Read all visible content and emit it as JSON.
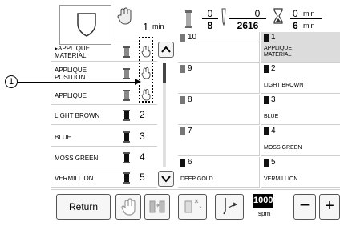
{
  "header": {
    "time_value": "1",
    "time_unit": "min",
    "stitch_fraction_top": "0",
    "stitch_fraction_bottom": "8",
    "stitch_count_top": "0",
    "stitch_count_bottom": "2616",
    "remaining_top_value": "0",
    "remaining_top_unit": "min",
    "remaining_bottom_value": "6",
    "remaining_bottom_unit": "min"
  },
  "color_list": [
    {
      "label": "APPLIQUE\nMATERIAL",
      "type": "hand",
      "current": true
    },
    {
      "label": "APPLIQUE\nPOSITION",
      "type": "hand"
    },
    {
      "label": "APPLIQUE",
      "type": "hand"
    },
    {
      "label": "LIGHT BROWN",
      "num": "2"
    },
    {
      "label": "BLUE",
      "num": "3"
    },
    {
      "label": "MOSS GREEN",
      "num": "4"
    },
    {
      "label": "VERMILLION",
      "num": "5"
    }
  ],
  "callout_number": "1",
  "spools": [
    {
      "num": "10",
      "name": ""
    },
    {
      "num": "1",
      "name": "APPLIQUE\nMATERIAL",
      "selected": true
    },
    {
      "num": "9",
      "name": ""
    },
    {
      "num": "2",
      "name": "LIGHT BROWN"
    },
    {
      "num": "8",
      "name": ""
    },
    {
      "num": "3",
      "name": "BLUE"
    },
    {
      "num": "7",
      "name": ""
    },
    {
      "num": "4",
      "name": "MOSS GREEN"
    },
    {
      "num": "6",
      "name": "DEEP GOLD"
    },
    {
      "num": "5",
      "name": "VERMILLION"
    }
  ],
  "footer": {
    "return_label": "Return",
    "speed_value": "1000",
    "speed_unit": "spm",
    "minus_label": "−",
    "plus_label": "+"
  }
}
